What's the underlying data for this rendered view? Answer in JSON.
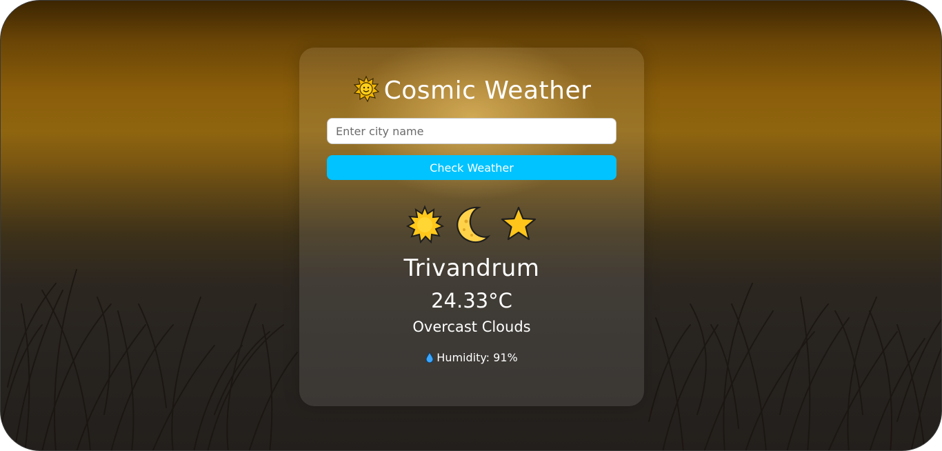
{
  "app": {
    "title": "Cosmic Weather",
    "title_icon": "sun-with-face-icon"
  },
  "search": {
    "placeholder": "Enter city name",
    "value": ""
  },
  "button": {
    "label": "Check Weather"
  },
  "weather": {
    "icons": [
      "sun-icon",
      "crescent-moon-icon",
      "star-icon"
    ],
    "city": "Trivandrum",
    "temperature": "24.33°C",
    "description": "Overcast Clouds",
    "humidity_icon": "droplet-icon",
    "humidity": "Humidity: 91%"
  },
  "colors": {
    "accent": "#00c3ff",
    "text": "#ffffff",
    "card_bg": "rgba(255,255,255,0.10)"
  }
}
